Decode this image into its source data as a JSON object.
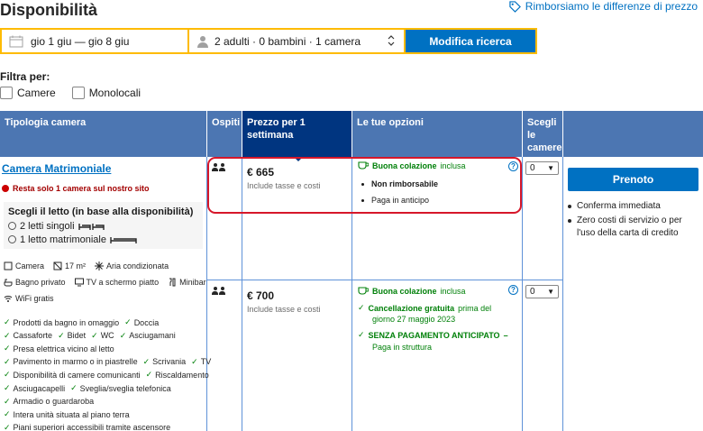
{
  "header": {
    "title": "Disponibilità",
    "price_match": "Rimborsiamo le differenze di prezzo"
  },
  "search": {
    "dates": "gio 1 giu — gio 8 giu",
    "guests": "2 adulti · 0 bambini · 1 camera",
    "button": "Modifica ricerca"
  },
  "filters": {
    "label": "Filtra per:",
    "options": [
      "Camere",
      "Monolocali"
    ]
  },
  "table": {
    "headers": {
      "room_type": "Tipologia camera",
      "guests": "Ospiti",
      "price": "Prezzo per 1 settimana",
      "options": "Le tue opzioni",
      "select": "Scegli le camere"
    }
  },
  "room": {
    "name": "Camera Matrimoniale",
    "scarcity": "Resta solo 1 camera sul nostro sito",
    "bed_title": "Scegli il letto (in base alla disponibilità)",
    "bed_options": [
      "2 letti singoli",
      "1 letto matrimoniale"
    ],
    "facilities": [
      "Camera",
      "17 m²",
      "Aria condizionata",
      "Bagno privato",
      "TV a schermo piatto",
      "Minibar",
      "WiFi gratis"
    ],
    "amenities": [
      [
        "Prodotti da bagno in omaggio",
        "Doccia"
      ],
      [
        "Cassaforte",
        "Bidet",
        "WC",
        "Asciugamani"
      ],
      [
        "Presa elettrica vicino al letto"
      ],
      [
        "Pavimento in marmo o in piastrelle",
        "Scrivania",
        "TV"
      ],
      [
        "Disponibilità di camere comunicanti",
        "Riscaldamento"
      ],
      [
        "Asciugacapelli",
        "Sveglia/sveglia telefonica"
      ],
      [
        "Armadio o guardaroba"
      ],
      [
        "Intera unità situata al piano terra"
      ],
      [
        "Piani superiori accessibili tramite ascensore"
      ]
    ]
  },
  "offers": [
    {
      "price": "€ 665",
      "price_note": "Include tasse e costi",
      "breakfast_bold": "Buona colazione",
      "breakfast_rest": "inclusa",
      "line1": "Non rimborsabile",
      "line2": "Paga in anticipo",
      "qty": "0"
    },
    {
      "price": "€ 700",
      "price_note": "Include tasse e costi",
      "breakfast_bold": "Buona colazione",
      "breakfast_rest": "inclusa",
      "cancel_bold": "Cancellazione gratuita",
      "cancel_rest": "prima del",
      "cancel_date": "giorno 27 maggio 2023",
      "nopay_bold": "SENZA PAGAMENTO ANTICIPATO",
      "nopay_dash": "–",
      "nopay_rest": "Paga in struttura",
      "qty": "0"
    }
  ],
  "reserve": {
    "button": "Prenoto",
    "benefits": [
      "Conferma immediata",
      "Zero costi di servizio o per l'uso della carta di credito"
    ]
  }
}
